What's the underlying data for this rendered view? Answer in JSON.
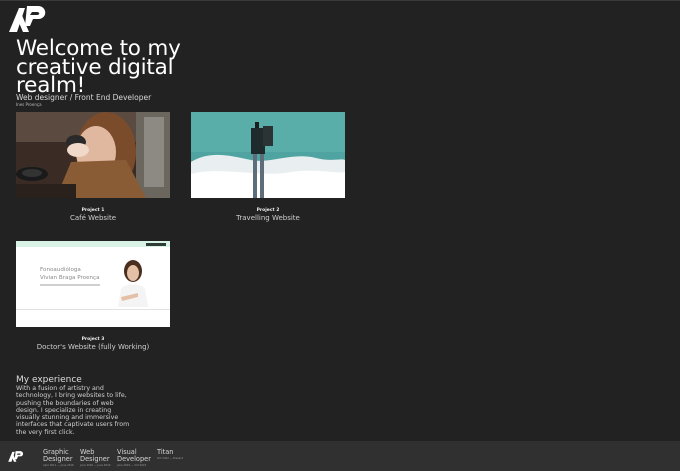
{
  "hero": {
    "title": "Welcome to my creative digital realm!",
    "subtitle": "Web designer / Front End Developer",
    "byline": "Ines Proença"
  },
  "projects": [
    {
      "number": "Project 1",
      "name": "Café Website"
    },
    {
      "number": "Project 2",
      "name": "Travelling Website"
    },
    {
      "number": "Project 3",
      "name": "Doctor's Website (fully Working)"
    }
  ],
  "doctor_preview": {
    "title_line1": "Fonoaudióloga",
    "title_line2": "Vivian Braga Proença"
  },
  "experience": {
    "title": "My experience",
    "body": "With a fusion of artistry and technology, I bring websites to life, pushing the boundaries of web design. I specialize in creating visually stunning and immersive interfaces that captivate users from the very first click."
  },
  "footer": {
    "items": [
      {
        "label": "Graphic Designer",
        "dates": "April 2011 — June 2016"
      },
      {
        "label": "Web Designer",
        "dates": "June 2016 — June 2019"
      },
      {
        "label": "Visual Developer",
        "dates": "June 2019 — Oct 2022"
      },
      {
        "label": "Titan",
        "dates": "Oct 2022 — Present"
      }
    ]
  },
  "colors": {
    "background": "#222222",
    "footer": "#303030",
    "accent_mint": "#d8f2e6"
  },
  "icons": {
    "logo": "ap-monogram-logo"
  }
}
